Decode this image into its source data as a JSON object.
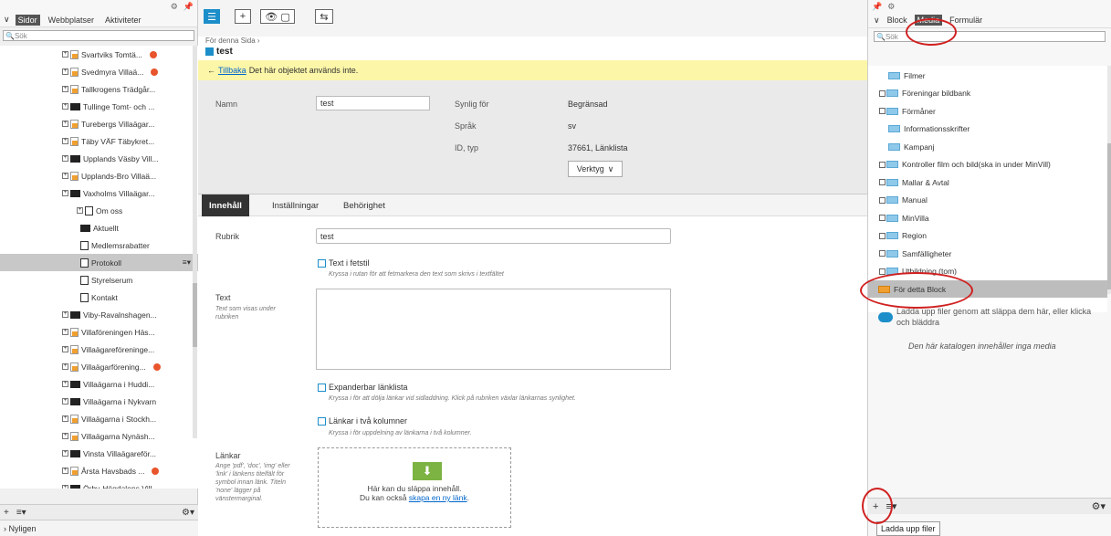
{
  "left_panel": {
    "tabs": [
      "Sidor",
      "Webbplatser",
      "Aktiviteter"
    ],
    "search_placeholder": "Sök",
    "tree": [
      {
        "label": "Svartviks Tomtä...",
        "icon": "orange-page",
        "warn": true,
        "indent": 0
      },
      {
        "label": "Svedmyra Villaä...",
        "icon": "orange-page",
        "warn": true,
        "indent": 0
      },
      {
        "label": "Tallkrogens Trädgår...",
        "icon": "orange-page",
        "warn": false,
        "indent": 0
      },
      {
        "label": "Tullinge Tomt- och ...",
        "icon": "folder",
        "warn": false,
        "indent": 0
      },
      {
        "label": "Turebergs Villaägar...",
        "icon": "orange-page",
        "warn": false,
        "indent": 0
      },
      {
        "label": "Täby VÄF Täbykret...",
        "icon": "orange-page",
        "warn": false,
        "indent": 0
      },
      {
        "label": "Upplands Väsby Vill...",
        "icon": "folder",
        "warn": false,
        "indent": 0
      },
      {
        "label": "Upplands-Bro Villaä...",
        "icon": "orange-page",
        "warn": false,
        "indent": 0
      },
      {
        "label": "Vaxholms Villaägar...",
        "icon": "folder",
        "warn": false,
        "indent": 0
      },
      {
        "label": "Om oss",
        "icon": "doc",
        "warn": false,
        "indent": 1
      },
      {
        "label": "Aktuellt",
        "icon": "folder",
        "warn": false,
        "indent": 2
      },
      {
        "label": "Medlemsrabatter",
        "icon": "doc",
        "warn": false,
        "indent": 2
      },
      {
        "label": "Protokoll",
        "icon": "doc",
        "warn": false,
        "indent": 2,
        "selected": true
      },
      {
        "label": "Styrelserum",
        "icon": "doc",
        "warn": false,
        "indent": 2
      },
      {
        "label": "Kontakt",
        "icon": "doc",
        "warn": false,
        "indent": 2
      },
      {
        "label": "Viby-Ravalnshagen...",
        "icon": "folder",
        "warn": false,
        "indent": 0
      },
      {
        "label": "Villaföreningen Häs...",
        "icon": "orange-page",
        "warn": false,
        "indent": 0
      },
      {
        "label": "Villaägareföreninge...",
        "icon": "orange-page",
        "warn": false,
        "indent": 0
      },
      {
        "label": "Villaägarförening...",
        "icon": "orange-page",
        "warn": true,
        "indent": 0
      },
      {
        "label": "Villaägarna i Huddi...",
        "icon": "folder",
        "warn": false,
        "indent": 0
      },
      {
        "label": "Villaägarna i Nykvarn",
        "icon": "folder",
        "warn": false,
        "indent": 0
      },
      {
        "label": "Villaägarna i Stockh...",
        "icon": "orange-page",
        "warn": false,
        "indent": 0
      },
      {
        "label": "Villaägarna Nynäsh...",
        "icon": "orange-page",
        "warn": false,
        "indent": 0
      },
      {
        "label": "Vinsta Villaägareför...",
        "icon": "folder",
        "warn": false,
        "indent": 0
      },
      {
        "label": "Årsta Havsbads ...",
        "icon": "orange-page",
        "warn": true,
        "indent": 0
      },
      {
        "label": "Örby-Högdalens Vill...",
        "icon": "folder",
        "warn": false,
        "indent": 0
      }
    ],
    "bottom_tab": "Nyligen"
  },
  "page": {
    "breadcrumb": "För denna Sida",
    "name": "test",
    "notice_link": "Tillbaka",
    "notice_text": "Det här objektet används inte.",
    "props": {
      "name_label": "Namn",
      "name_value": "test",
      "visible_label": "Synlig för",
      "visible_value": "Begränsad",
      "lang_label": "Språk",
      "lang_value": "sv",
      "id_label": "ID, typ",
      "id_value": "37661, Länklista",
      "tools_button": "Verktyg"
    },
    "tabs": [
      "Innehåll",
      "Inställningar",
      "Behörighet"
    ],
    "form": {
      "rubrik_label": "Rubrik",
      "rubrik_value": "test",
      "bold_label": "Text i fetstil",
      "bold_help": "Kryssa i rutan för att fetmarkera den text som skrivs i textfältet",
      "text_label": "Text",
      "text_help": "Text som visas under rubriken",
      "expand_label": "Expanderbar länklista",
      "expand_help": "Kryssa i för att dölja länkar vid sidladdning. Klick på rubriken växlar länkarnas synlighet.",
      "cols_label": "Länkar i två kolumner",
      "cols_help": "Kryssa i för uppdelning av länkarna i två kolumner.",
      "links_label": "Länkar",
      "links_help": "Ange 'pdf', 'doc', 'img' eller 'link' i länkens titelfält för symbol innan länk. Titeln 'none' lägger på vänstermarginal.",
      "drop_text": "Här kan du släppa innehåll.",
      "drop_text2": "Du kan också",
      "drop_link": "skapa en ny länk"
    }
  },
  "right_panel": {
    "tabs": [
      "Block",
      "Media",
      "Formulär"
    ],
    "search_placeholder": "Sök",
    "items": [
      {
        "label": "Filmer",
        "expandable": false
      },
      {
        "label": "Föreningar bildbank",
        "expandable": true
      },
      {
        "label": "Förmåner",
        "expandable": true
      },
      {
        "label": "Informationsskrifter",
        "expandable": false
      },
      {
        "label": "Kampanj",
        "expandable": false
      },
      {
        "label": "Kontroller film och bild(ska in under MinVill)",
        "expandable": true
      },
      {
        "label": "Mallar & Avtal",
        "expandable": true
      },
      {
        "label": "Manual",
        "expandable": true
      },
      {
        "label": "MinVilla",
        "expandable": true
      },
      {
        "label": "Region",
        "expandable": true
      },
      {
        "label": "Samfälligheter",
        "expandable": true
      },
      {
        "label": "Utbildning (tom)",
        "expandable": true
      },
      {
        "label": "För detta Block",
        "expandable": false,
        "selected": true
      }
    ],
    "upload_text": "Ladda upp filer genom att släppa dem här, eller klicka och bläddra",
    "empty_text": "Den här katalogen innehåller inga media",
    "tooltip": "Ladda upp filer"
  },
  "colors": {
    "accent": "#1c8ec9",
    "notice": "#fcf6a8",
    "highlight": "#d02020"
  }
}
